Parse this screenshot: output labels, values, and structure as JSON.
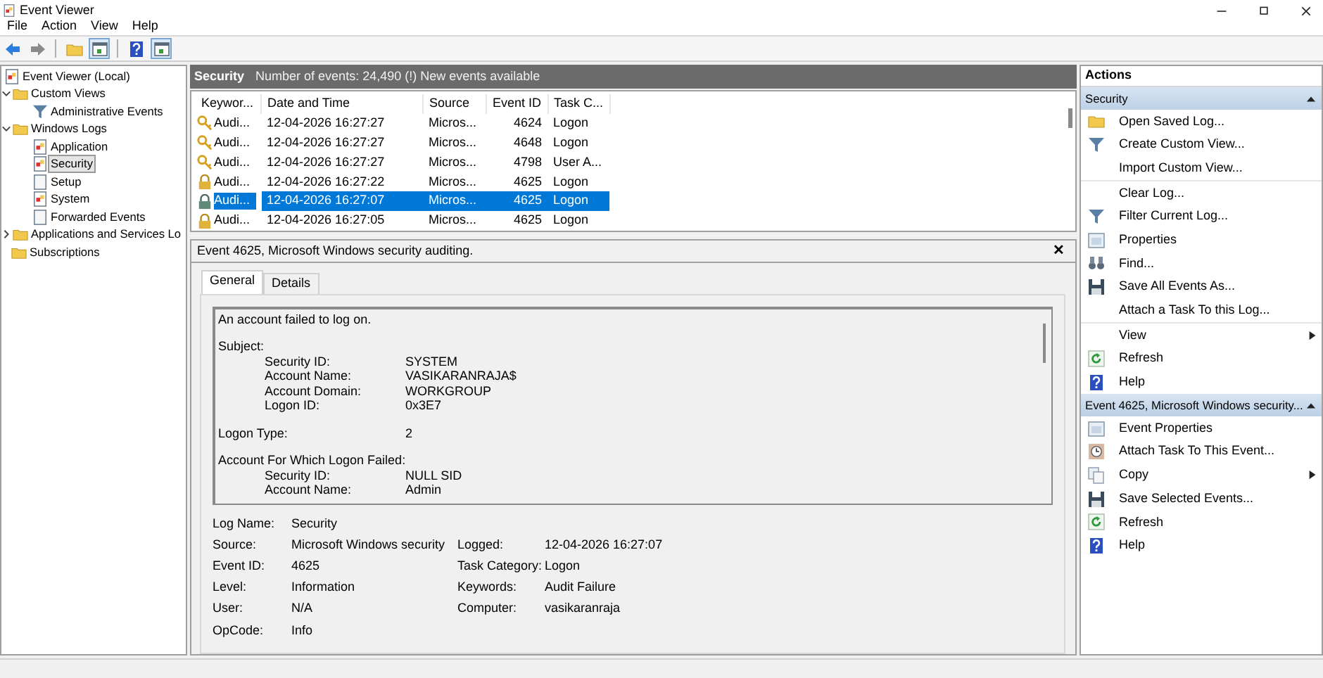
{
  "window": {
    "title": "Event Viewer"
  },
  "menu": [
    "File",
    "Action",
    "View",
    "Help"
  ],
  "toolbar": [
    {
      "kind": "back",
      "pressed": false
    },
    {
      "kind": "forward",
      "pressed": false
    },
    {
      "kind": "separator"
    },
    {
      "kind": "folder",
      "pressed": false
    },
    {
      "kind": "panel",
      "pressed": true
    },
    {
      "kind": "separator"
    },
    {
      "kind": "help",
      "pressed": false
    },
    {
      "kind": "panel",
      "pressed": true
    }
  ],
  "tree": [
    {
      "label": "Event Viewer (Local)",
      "kind": "log",
      "selected": false,
      "children": [
        {
          "label": "Custom Views",
          "kind": "folder",
          "expanded": true,
          "selected": false,
          "children": [
            {
              "label": "Administrative Events",
              "kind": "filter",
              "selected": false
            }
          ]
        },
        {
          "label": "Windows Logs",
          "kind": "folder",
          "expanded": true,
          "selected": false,
          "children": [
            {
              "label": "Application",
              "kind": "log",
              "selected": false
            },
            {
              "label": "Security",
              "kind": "log",
              "selected": true
            },
            {
              "label": "Setup",
              "kind": "page",
              "selected": false
            },
            {
              "label": "System",
              "kind": "log",
              "selected": false
            },
            {
              "label": "Forwarded Events",
              "kind": "page",
              "selected": false
            }
          ]
        },
        {
          "label": "Applications and Services Lo",
          "kind": "folder",
          "expanded": false,
          "selected": false
        },
        {
          "label": "Subscriptions",
          "kind": "folder",
          "selected": false
        }
      ]
    }
  ],
  "log_header": {
    "title": "Security",
    "info": "Number of events: 24,490 (!) New events available"
  },
  "events": {
    "columns": [
      "Keywor...",
      "Date and Time",
      "Source",
      "Event ID",
      "Task C..."
    ],
    "rows": [
      {
        "kind": "key",
        "keywords": "Audi...",
        "date": "12-04-2026 16:27:27",
        "source": "Micros...",
        "event_id": "4624",
        "task": "Logon",
        "selected": false
      },
      {
        "kind": "key",
        "keywords": "Audi...",
        "date": "12-04-2026 16:27:27",
        "source": "Micros...",
        "event_id": "4648",
        "task": "Logon",
        "selected": false
      },
      {
        "kind": "key",
        "keywords": "Audi...",
        "date": "12-04-2026 16:27:27",
        "source": "Micros...",
        "event_id": "4798",
        "task": "User A...",
        "selected": false
      },
      {
        "kind": "lock",
        "keywords": "Audi...",
        "date": "12-04-2026 16:27:22",
        "source": "Micros...",
        "event_id": "4625",
        "task": "Logon",
        "selected": false
      },
      {
        "kind": "lock",
        "keywords": "Audi...",
        "date": "12-04-2026 16:27:07",
        "source": "Micros...",
        "event_id": "4625",
        "task": "Logon",
        "selected": true
      },
      {
        "kind": "lock",
        "keywords": "Audi...",
        "date": "12-04-2026 16:27:05",
        "source": "Micros...",
        "event_id": "4625",
        "task": "Logon",
        "selected": false
      }
    ]
  },
  "detail": {
    "title": "Event 4625, Microsoft Windows security auditing.",
    "close": "✕",
    "tabs": [
      {
        "label": "General",
        "selected": true
      },
      {
        "label": "Details",
        "selected": false
      }
    ],
    "description": [
      [
        {
          "kind": "text",
          "text": "An account failed to log on."
        }
      ],
      [
        {
          "kind": "heading",
          "text": "Subject:"
        },
        {
          "kind": "field",
          "label": "Security ID:",
          "value": "SYSTEM"
        },
        {
          "kind": "field",
          "label": "Account Name:",
          "value": "VASIKARANRAJA$"
        },
        {
          "kind": "field",
          "label": "Account Domain:",
          "value": "WORKGROUP"
        },
        {
          "kind": "field",
          "label": "Logon ID:",
          "value": "0x3E7"
        }
      ],
      [
        {
          "kind": "pair",
          "label": "Logon Type:",
          "value": "2"
        }
      ],
      [
        {
          "kind": "heading",
          "text": "Account For Which Logon Failed:"
        },
        {
          "kind": "field",
          "label": "Security ID:",
          "value": "NULL SID"
        },
        {
          "kind": "field",
          "label": "Account Name:",
          "value": "Admin"
        }
      ]
    ],
    "properties": [
      {
        "left": {
          "label": "Log Name:",
          "value": "Security"
        }
      },
      {
        "left": {
          "label": "Source:",
          "value": "Microsoft Windows security"
        },
        "right": {
          "label": "Logged:",
          "value": "12-04-2026 16:27:07"
        }
      },
      {
        "left": {
          "label": "Event ID:",
          "value": "4625"
        },
        "right": {
          "label": "Task Category:",
          "value": "Logon"
        }
      },
      {
        "left": {
          "label": "Level:",
          "value": "Information"
        },
        "right": {
          "label": "Keywords:",
          "value": "Audit Failure"
        }
      },
      {
        "left": {
          "label": "User:",
          "value": "N/A"
        },
        "right": {
          "label": "Computer:",
          "value": "vasikaranraja"
        }
      },
      {
        "left": {
          "label": "OpCode:",
          "value": "Info"
        }
      }
    ]
  },
  "actions": {
    "title": "Actions",
    "sections": [
      {
        "title": "Security",
        "expanded": true,
        "groups": [
          [
            {
              "label": "Open Saved Log...",
              "kind": "folder",
              "submenu": false
            },
            {
              "label": "Create Custom View...",
              "kind": "filter",
              "submenu": false
            },
            {
              "label": "Import Custom View...",
              "kind": "plain",
              "submenu": false
            }
          ],
          [
            {
              "label": "Clear Log...",
              "kind": "plain",
              "submenu": false
            },
            {
              "label": "Filter Current Log...",
              "kind": "filter",
              "submenu": false
            },
            {
              "label": "Properties",
              "kind": "window",
              "submenu": false
            },
            {
              "label": "Find...",
              "kind": "binoculars",
              "submenu": false
            },
            {
              "label": "Save All Events As...",
              "kind": "floppy",
              "submenu": false
            },
            {
              "label": "Attach a Task To this Log...",
              "kind": "plain",
              "submenu": false
            }
          ],
          [
            {
              "label": "View",
              "kind": "plain",
              "submenu": true
            },
            {
              "label": "Refresh",
              "kind": "refresh",
              "submenu": false
            },
            {
              "label": "Help",
              "kind": "help",
              "submenu": false
            }
          ]
        ]
      },
      {
        "title": "Event 4625, Microsoft Windows security...",
        "expanded": true,
        "groups": [
          [
            {
              "label": "Event Properties",
              "kind": "window",
              "submenu": false
            },
            {
              "label": "Attach Task To This Event...",
              "kind": "clock",
              "submenu": false
            },
            {
              "label": "Copy",
              "kind": "copy",
              "submenu": true
            },
            {
              "label": "Save Selected Events...",
              "kind": "floppy",
              "submenu": false
            },
            {
              "label": "Refresh",
              "kind": "refresh",
              "submenu": false
            },
            {
              "label": "Help",
              "kind": "help",
              "submenu": false
            }
          ]
        ]
      }
    ]
  }
}
